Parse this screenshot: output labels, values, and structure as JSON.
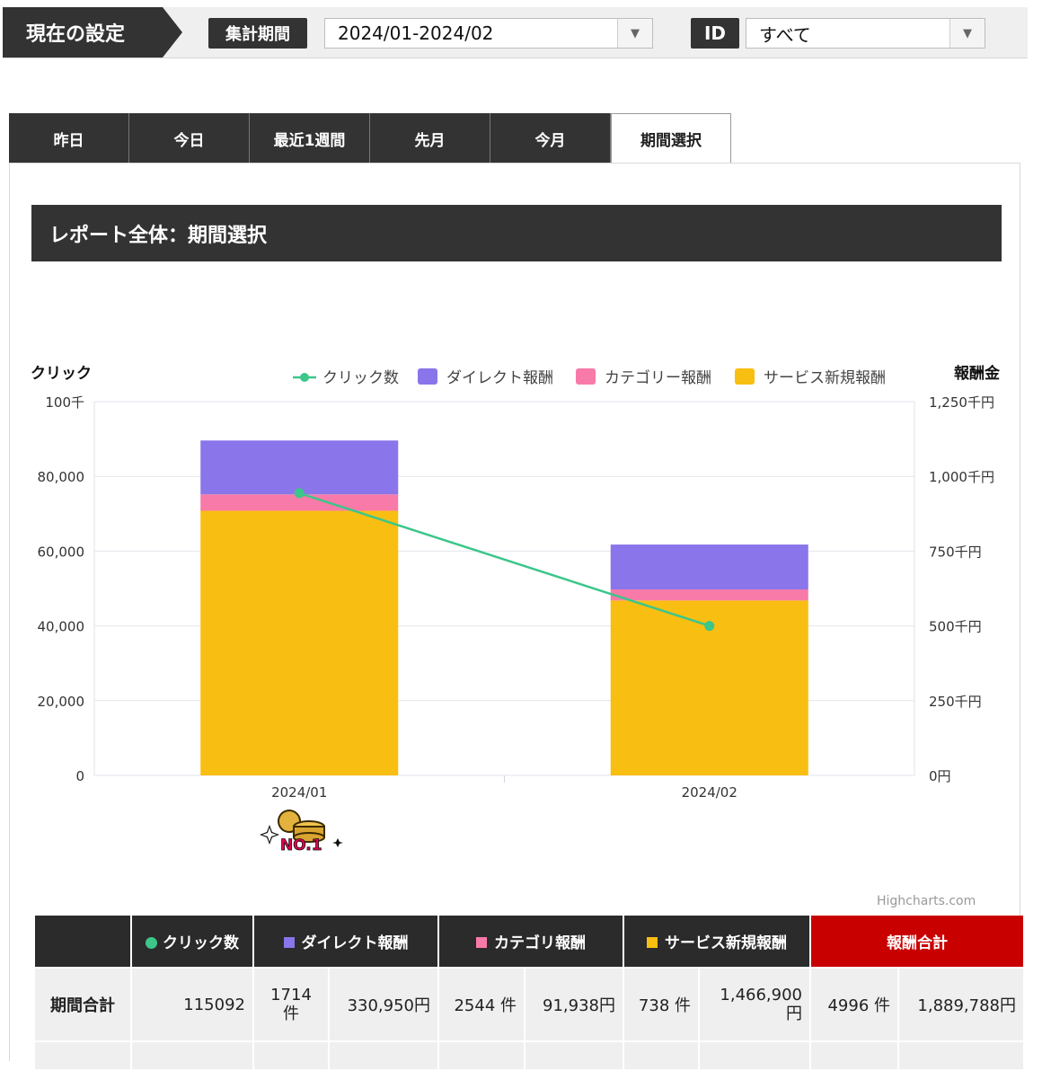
{
  "settings": {
    "label": "現在の設定",
    "period_tag": "集計期間",
    "period_value": "2024/01-2024/02",
    "id_tag": "ID",
    "id_value": "すべて"
  },
  "tabs": [
    {
      "label": "昨日",
      "active": false
    },
    {
      "label": "今日",
      "active": false
    },
    {
      "label": "最近1週間",
      "active": false
    },
    {
      "label": "先月",
      "active": false
    },
    {
      "label": "今月",
      "active": false
    },
    {
      "label": "期間選択",
      "active": true
    }
  ],
  "report_title": "レポート全体：期間選択",
  "badge_text": "NO.1",
  "credit": "Highcharts.com",
  "colors": {
    "clicks": "#3cc68a",
    "direct": "#8a75ea",
    "category": "#f77aa8",
    "service": "#f9be12",
    "dark": "#333333",
    "total": "#c90000"
  },
  "chart_data": {
    "type": "bar",
    "categories": [
      "2024/01",
      "2024/02"
    ],
    "left_axis": {
      "title": "クリック",
      "range": [
        0,
        100000
      ],
      "ticks": [
        0,
        20000,
        40000,
        60000,
        80000,
        100000
      ],
      "tick_labels": [
        "0",
        "20,000",
        "40,000",
        "60,000",
        "80,000",
        "100千"
      ]
    },
    "right_axis": {
      "title": "報酬金",
      "range": [
        0,
        1250000
      ],
      "ticks": [
        0,
        250000,
        500000,
        750000,
        1000000,
        1250000
      ],
      "tick_labels": [
        "0円",
        "250千円",
        "500千円",
        "750千円",
        "1,000千円",
        "1,250千円"
      ]
    },
    "legend": [
      "クリック数",
      "ダイレクト報酬",
      "カテゴリー報酬",
      "サービス新規報酬"
    ],
    "legend_placement": "top-right",
    "series": [
      {
        "name": "サービス新規報酬",
        "axis": "right",
        "stack": "reward",
        "values": [
          885000,
          585000
        ]
      },
      {
        "name": "カテゴリー報酬",
        "axis": "right",
        "stack": "reward",
        "values": [
          55000,
          37000
        ]
      },
      {
        "name": "ダイレクト報酬",
        "axis": "right",
        "stack": "reward",
        "values": [
          180000,
          150000
        ]
      },
      {
        "name": "クリック数",
        "axis": "left",
        "type": "line",
        "values": [
          75500,
          40000
        ]
      }
    ],
    "grid": true
  },
  "table": {
    "headers": [
      "",
      "クリック数",
      "ダイレクト報酬",
      "カテゴリ報酬",
      "サービス新規報酬",
      "報酬合計"
    ],
    "rows": [
      {
        "label": "期間合計",
        "clicks": "115092",
        "direct_count_num": "1714",
        "direct_count_unit": "件",
        "direct_amount": "330,950円",
        "category_count": "2544 件",
        "category_amount": "91,938円",
        "service_count": "738 件",
        "service_amount_num": "1,466,900",
        "service_amount_unit": "円",
        "total_count": "4996 件",
        "total_amount": "1,889,788円"
      }
    ]
  }
}
